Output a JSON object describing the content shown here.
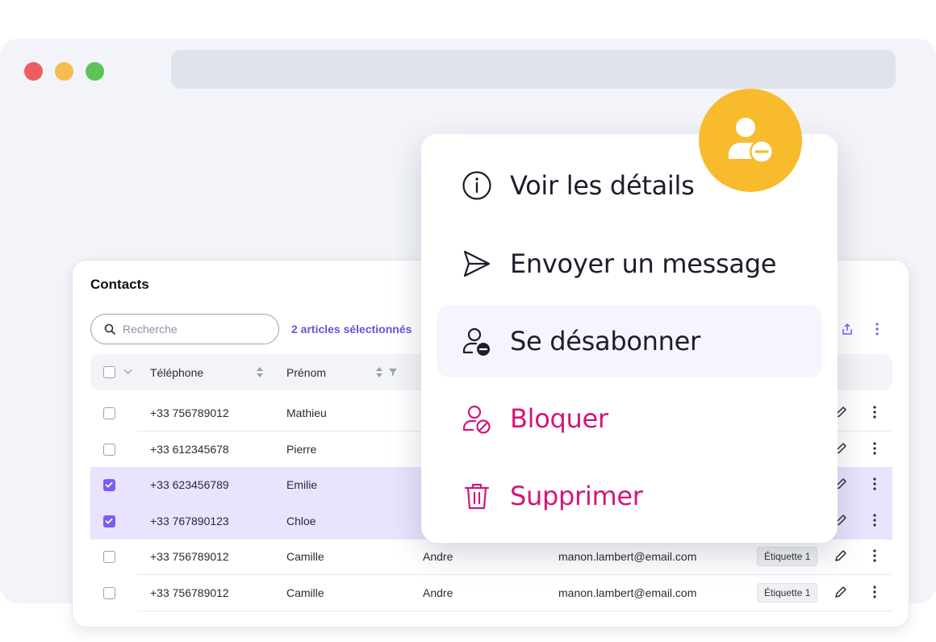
{
  "window": {
    "controls": [
      "close",
      "minimize",
      "maximize"
    ],
    "colors": {
      "close": "#ec5f5f",
      "minimize": "#f5bd4f",
      "maximize": "#5cc456"
    }
  },
  "contacts": {
    "title": "Contacts",
    "search": {
      "placeholder": "Recherche",
      "value": ""
    },
    "selection_label": "2 articles sélectionnés",
    "columns": [
      "Téléphone",
      "Prénom"
    ],
    "rows": [
      {
        "phone": "+33 756789012",
        "first_name": "Mathieu",
        "selected": false
      },
      {
        "phone": "+33 612345678",
        "first_name": "Pierre",
        "selected": false
      },
      {
        "phone": "+33 623456789",
        "first_name": "Emilie",
        "selected": true
      },
      {
        "phone": "+33 767890123",
        "first_name": "Chloe",
        "selected": true
      },
      {
        "phone": "+33 756789012",
        "first_name": "Camille",
        "last_name": "Andre",
        "email": "manon.lambert@email.com",
        "tag": "Étiquette 1",
        "selected": false
      },
      {
        "phone": "+33 756789012",
        "first_name": "Camille",
        "last_name": "Andre",
        "email": "manon.lambert@email.com",
        "tag": "Étiquette 1",
        "selected": false
      }
    ]
  },
  "context_menu": {
    "items": [
      {
        "label": "Voir les détails",
        "icon": "info-icon",
        "variant": "default"
      },
      {
        "label": "Envoyer un message",
        "icon": "send-icon",
        "variant": "default"
      },
      {
        "label": "Se désabonner",
        "icon": "user-minus-icon",
        "variant": "active"
      },
      {
        "label": "Bloquer",
        "icon": "user-block-icon",
        "variant": "danger"
      },
      {
        "label": "Supprimer",
        "icon": "trash-icon",
        "variant": "danger"
      }
    ]
  },
  "badge": {
    "icon": "user-minus-icon"
  },
  "colors": {
    "accent": "#7b5cf0",
    "danger": "#d4157a",
    "badge": "#f8bb2e",
    "selected_row": "#e9e3fd"
  }
}
